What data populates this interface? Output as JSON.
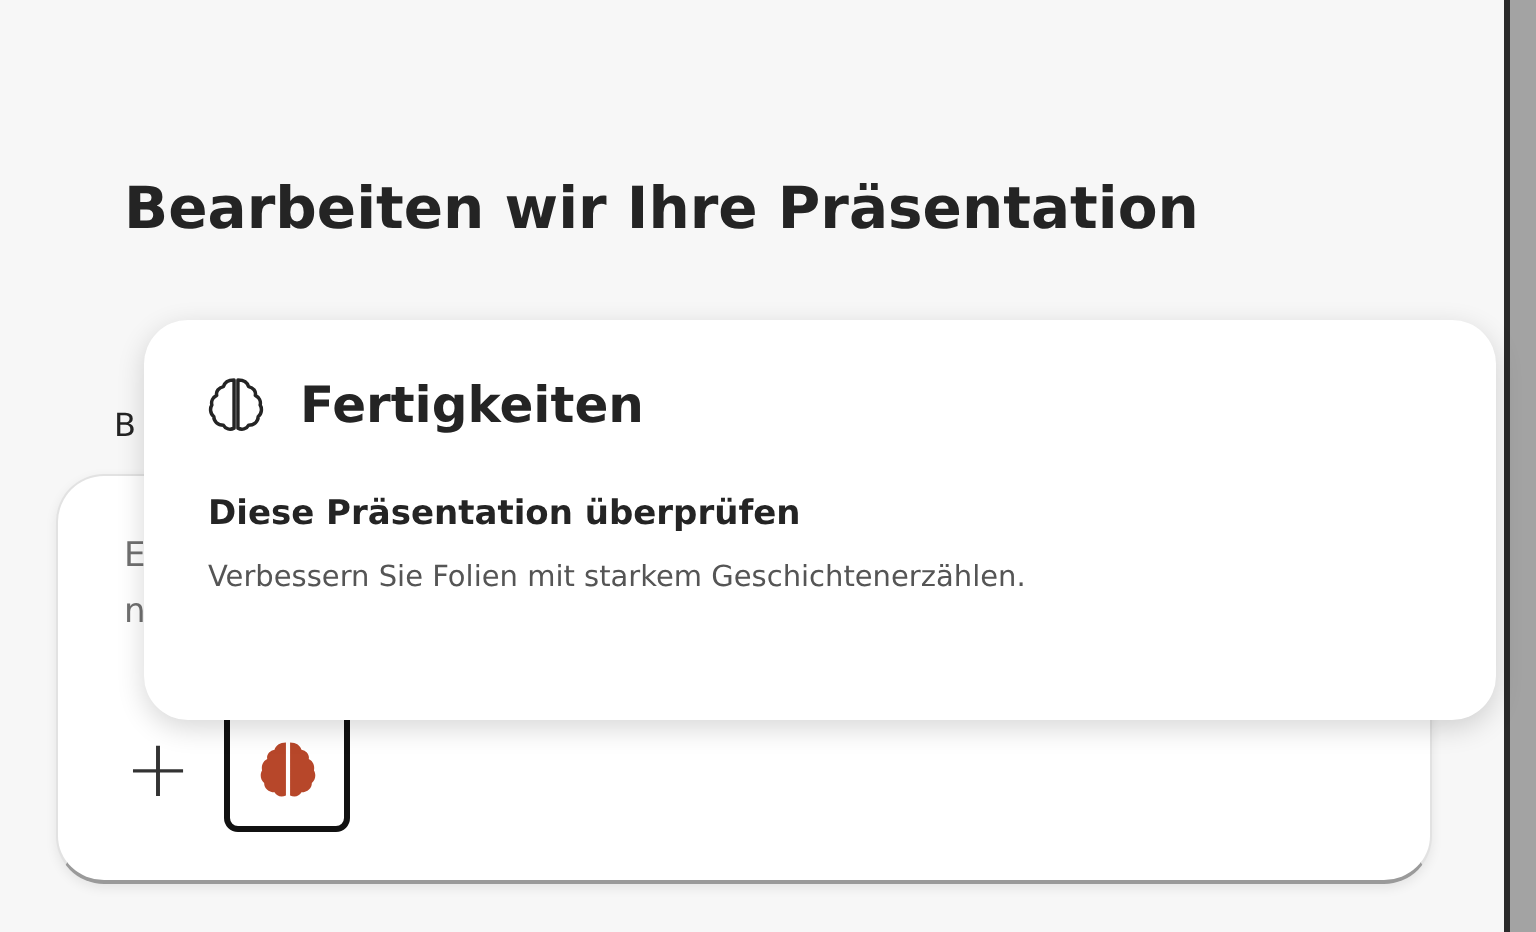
{
  "heading": "Bearbeiten wir Ihre Präsentation",
  "prompt_label": "B",
  "prompt_field": {
    "visible_lines": [
      "E",
      "n"
    ]
  },
  "toolbar": {
    "add_button": {
      "label": "+"
    },
    "skills_button": {
      "selected": true
    }
  },
  "skills_popup": {
    "title": "Fertigkeiten",
    "items": [
      {
        "title": "Diese Präsentation überprüfen",
        "description": "Verbessern Sie Folien mit starkem Geschichtenerzählen."
      }
    ]
  }
}
